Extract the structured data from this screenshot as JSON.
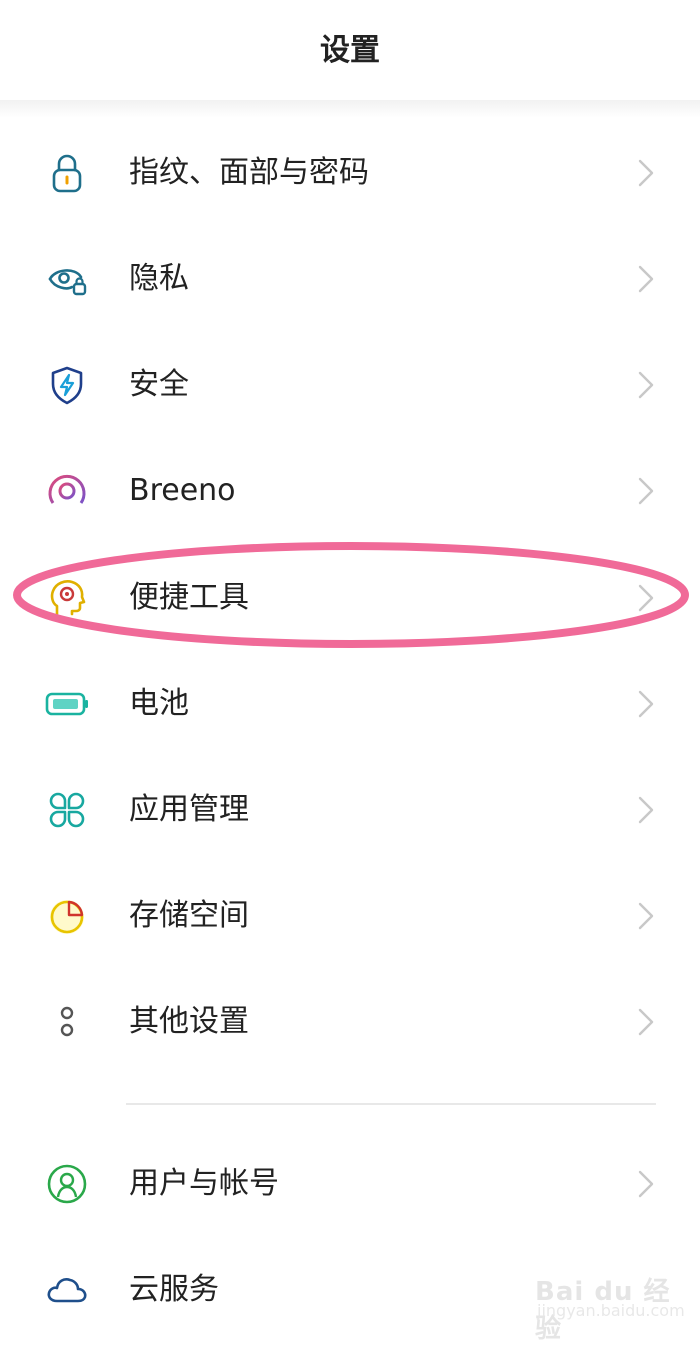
{
  "header": {
    "title": "设置"
  },
  "settings": {
    "items": [
      {
        "label": "指纹、面部与密码",
        "icon": "lock-icon",
        "color": "#1f6f8b"
      },
      {
        "label": "隐私",
        "icon": "privacy-eye-lock-icon",
        "color": "#1f6f8b"
      },
      {
        "label": "安全",
        "icon": "shield-bolt-icon",
        "color": "#1f3f8b"
      },
      {
        "label": "Breeno",
        "icon": "breeno-ring-icon",
        "color": "#c0478f"
      },
      {
        "label": "便捷工具",
        "icon": "head-profile-icon",
        "color": "#e0b000"
      },
      {
        "label": "电池",
        "icon": "battery-icon",
        "color": "#1ab3a0"
      },
      {
        "label": "应用管理",
        "icon": "app-grid-icon",
        "color": "#18a8a0"
      },
      {
        "label": "存储空间",
        "icon": "pie-chart-icon",
        "color": "#d88a00"
      },
      {
        "label": "其他设置",
        "icon": "more-dots-icon",
        "color": "#555555"
      },
      {
        "label": "用户与帐号",
        "icon": "user-icon",
        "color": "#2aa84a"
      },
      {
        "label": "云服务",
        "icon": "cloud-icon",
        "color": "#1f4f8b"
      }
    ]
  },
  "annotation": {
    "highlight_color": "#f06a98",
    "highlighted_item": "便捷工具"
  },
  "watermark": {
    "brand": "Bai du 经验",
    "site": "jingyan.baidu.com"
  }
}
